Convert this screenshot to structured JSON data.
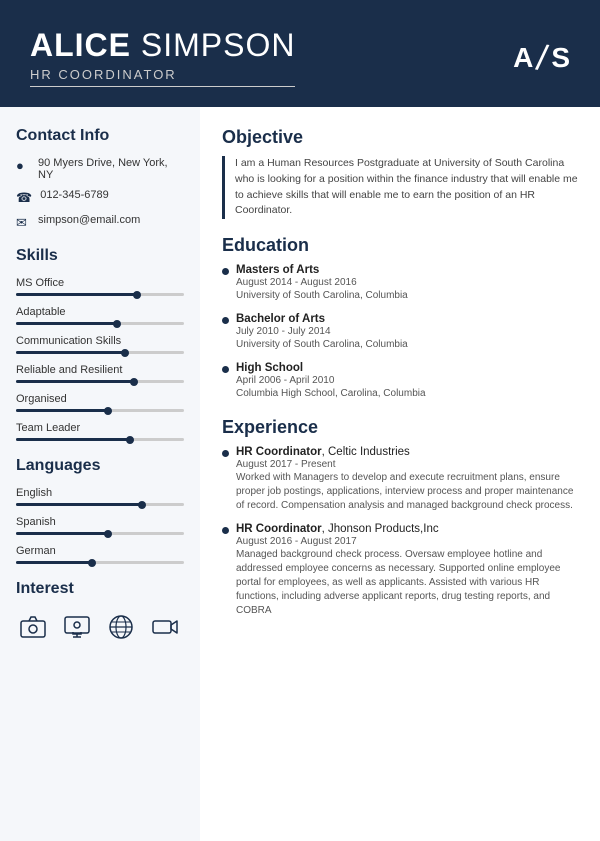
{
  "header": {
    "first_name": "ALICE",
    "last_name": "SIMPSON",
    "title": "HR COORDINATOR",
    "monogram_a": "A",
    "monogram_sep": "/",
    "monogram_s": "S"
  },
  "sidebar": {
    "contact_section": "Contact Info",
    "address": "90 Myers Drive, New York, NY",
    "phone": "012-345-6789",
    "email": "simpson@email.com",
    "skills_section": "Skills",
    "skills": [
      {
        "label": "MS Office",
        "pct": 72
      },
      {
        "label": "Adaptable",
        "pct": 60
      },
      {
        "label": "Communication Skills",
        "pct": 65
      },
      {
        "label": "Reliable and Resilient",
        "pct": 70
      },
      {
        "label": "Organised",
        "pct": 55
      },
      {
        "label": "Team Leader",
        "pct": 68
      }
    ],
    "languages_section": "Languages",
    "languages": [
      {
        "label": "English",
        "pct": 75
      },
      {
        "label": "Spanish",
        "pct": 55
      },
      {
        "label": "German",
        "pct": 45
      }
    ],
    "interest_section": "Interest",
    "interests": [
      "camera-icon",
      "person-screen-icon",
      "globe-icon",
      "video-icon"
    ]
  },
  "main": {
    "objective_section": "Objective",
    "objective_text": "I am a Human Resources Postgraduate at University of South Carolina who is looking for a position within the finance industry that will enable me to achieve skills that will enable me to earn the position of an HR Coordinator.",
    "education_section": "Education",
    "education": [
      {
        "degree": "Masters of Arts",
        "date": "August 2014 - August 2016",
        "school": "University of South Carolina, Columbia"
      },
      {
        "degree": "Bachelor of Arts",
        "date": "July 2010 - July 2014",
        "school": "University of South Carolina, Columbia"
      },
      {
        "degree": "High School",
        "date": "April 2006 - April 2010",
        "school": "Columbia High School, Carolina, Columbia"
      }
    ],
    "experience_section": "Experience",
    "experience": [
      {
        "title": "HR Coordinator",
        "company": "Celtic Industries",
        "date": "August 2017 - Present",
        "desc": "Worked with Managers to develop and execute recruitment plans, ensure proper job postings, applications, interview process and proper maintenance of record. Compensation analysis and managed background check process."
      },
      {
        "title": "HR Coordinator",
        "company": "Jhonson Products,Inc",
        "date": "August 2016 - August 2017",
        "desc": "Managed background check process. Oversaw employee hotline and addressed employee concerns as necessary. Supported online employee portal for employees, as well as applicants. Assisted with various HR functions, including adverse applicant reports, drug testing reports, and COBRA"
      }
    ]
  }
}
